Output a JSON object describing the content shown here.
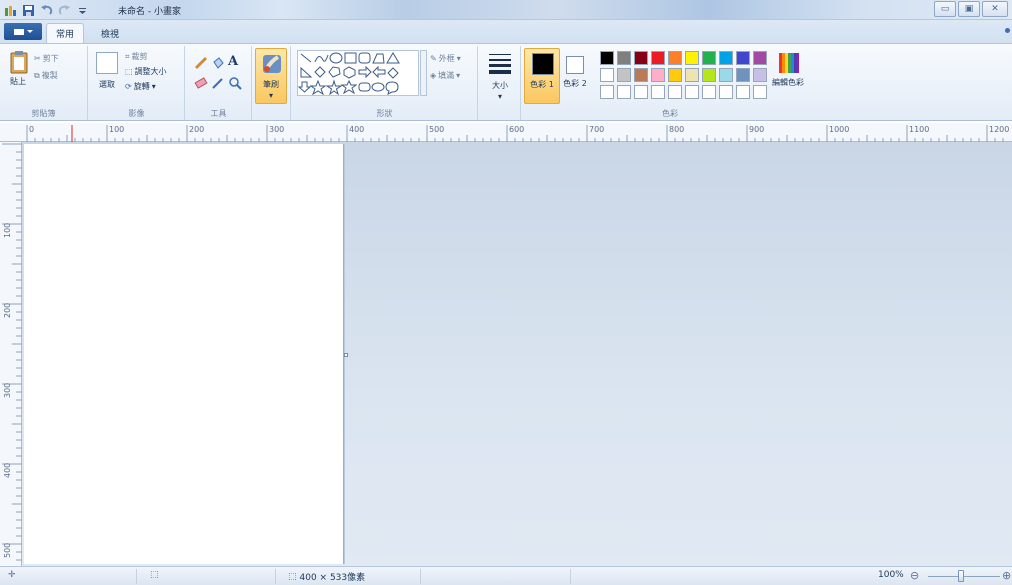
{
  "window": {
    "title": "未命名 - 小畫家",
    "controls": [
      "minimize",
      "maximize",
      "close"
    ]
  },
  "tabs": {
    "home": "常用",
    "view": "檢視"
  },
  "ribbon": {
    "clipboard": {
      "label": "剪貼簿",
      "paste": "貼上",
      "cut": "剪下",
      "copy": "複製"
    },
    "image": {
      "label": "影像",
      "select": "選取",
      "crop": "裁剪",
      "resize": "調整大小",
      "rotate": "旋轉"
    },
    "tools": {
      "label": "工具"
    },
    "brushes": {
      "label": "筆刷"
    },
    "shapes": {
      "label": "形狀",
      "outline": "外框",
      "fill": "填滿"
    },
    "size": {
      "label": "大小"
    },
    "colors": {
      "label": "色彩",
      "color1": "色彩 1",
      "color2": "色彩 2",
      "edit": "編輯色彩",
      "color1_value": "#000000",
      "color2_value": "#ffffff",
      "palette_row1": [
        "#000000",
        "#7f7f7f",
        "#880015",
        "#ed1c24",
        "#ff7f27",
        "#fff200",
        "#22b14c",
        "#00a2e8",
        "#3f48cc",
        "#a349a4"
      ],
      "palette_row2": [
        "#ffffff",
        "#c3c3c3",
        "#b97a57",
        "#ffaec9",
        "#ffc90e",
        "#efe4b0",
        "#b5e61d",
        "#99d9ea",
        "#7092be",
        "#c8bfe7"
      ],
      "palette_row3": [
        "#ffffff",
        "#ffffff",
        "#ffffff",
        "#ffffff",
        "#ffffff",
        "#ffffff",
        "#ffffff",
        "#ffffff",
        "#ffffff",
        "#ffffff"
      ]
    }
  },
  "ruler": {
    "h_ticks": [
      "0",
      "100",
      "200",
      "300",
      "400",
      "500",
      "600",
      "700",
      "800",
      "900",
      "1000",
      "1100",
      "1200"
    ],
    "v_ticks": [
      "100",
      "200",
      "300",
      "400",
      "500"
    ]
  },
  "statusbar": {
    "dimensions": "400 × 533像素",
    "zoom": "100%"
  }
}
